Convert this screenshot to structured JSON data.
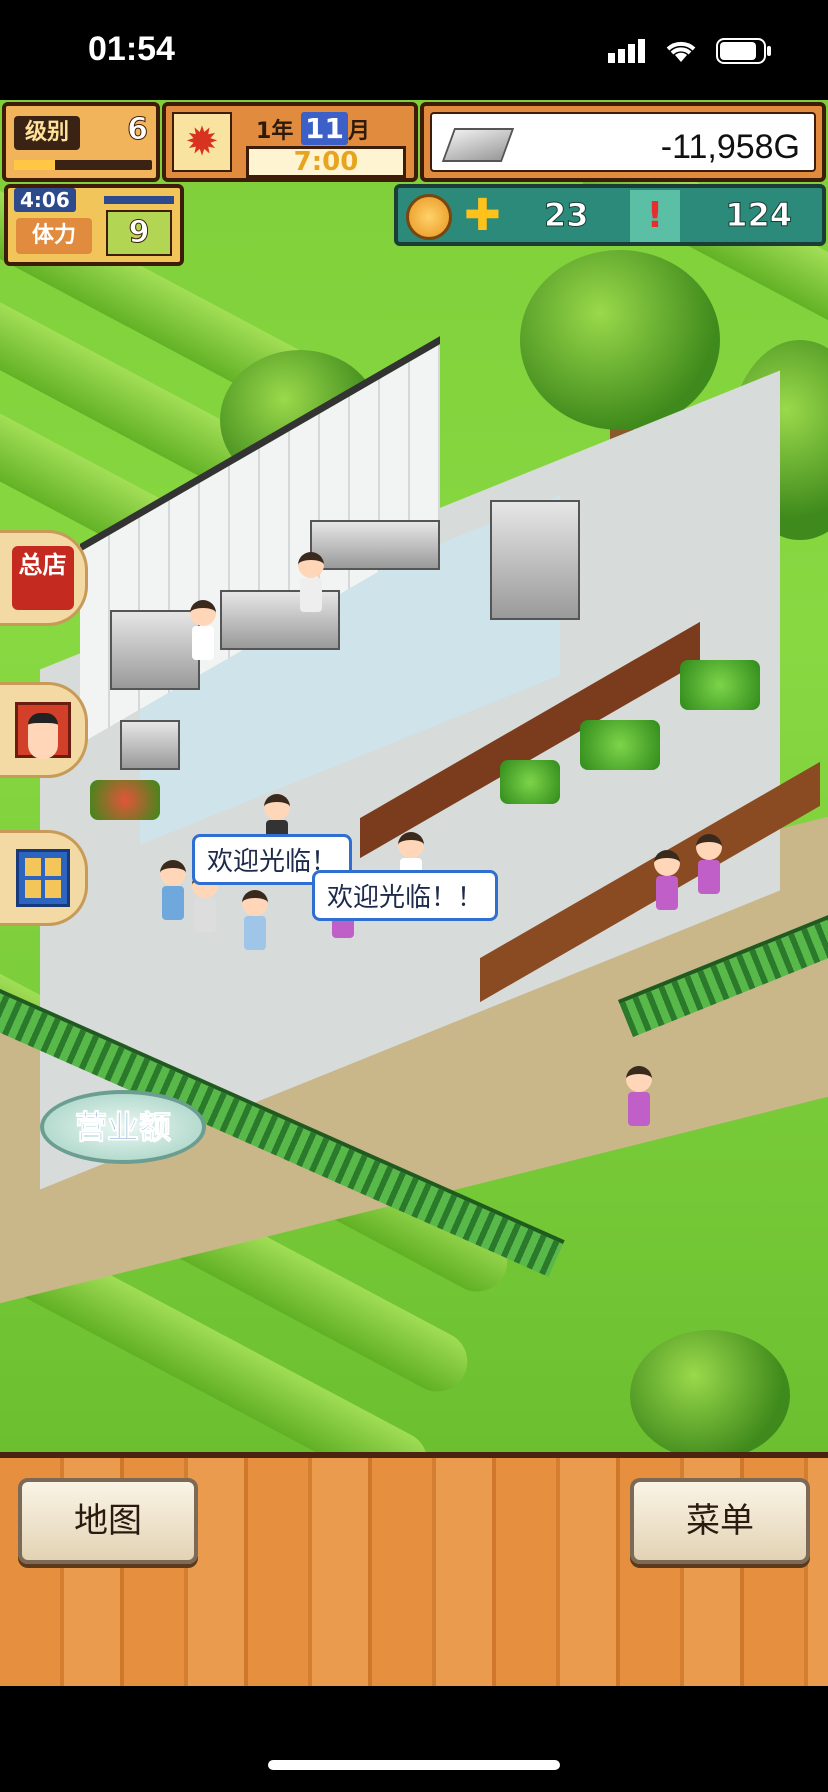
{
  "status_bar": {
    "time": "01:54",
    "icons": [
      "signal-icon",
      "wifi-icon",
      "battery-icon"
    ]
  },
  "hud": {
    "level_label": "级别",
    "level_value": "6",
    "level_progress": 0.3,
    "date_year": "1",
    "date_year_suffix": "年",
    "date_month": "11",
    "date_month_suffix": "月",
    "time": "7:00",
    "season_icon": "maple-leaf-icon",
    "money": "-11,958G",
    "stamina_timer": "4:06",
    "stamina_label": "体力",
    "stamina_value": "9",
    "coins_value": "23",
    "alerts_value": "124"
  },
  "side_menu": {
    "shop_label": "总店"
  },
  "speech": {
    "bubble1": "欢迎光临！",
    "bubble2": "欢迎光临！！"
  },
  "buttons": {
    "sales": "营业额",
    "map": "地图",
    "menu": "菜单"
  },
  "colors": {
    "grass": "#7fcf3a",
    "hud_border": "#3d1c08",
    "wood": "#e6903f",
    "speech_border": "#2f6fd2"
  }
}
